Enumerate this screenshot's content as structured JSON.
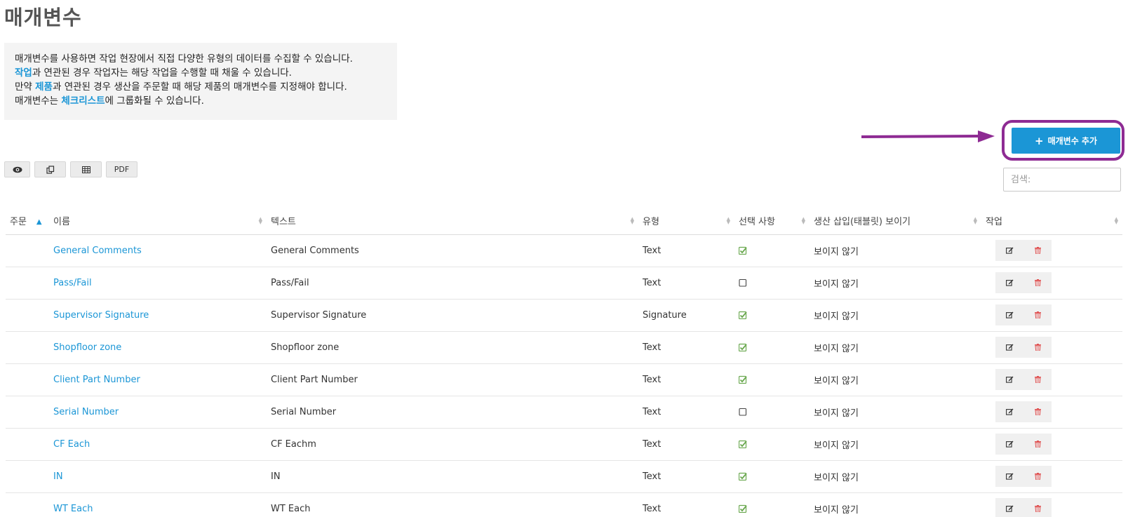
{
  "page": {
    "title": "매개변수"
  },
  "info": {
    "line1": "매개변수를 사용하면 작업 현장에서 직접 다양한 유형의 데이터를 수집할 수 있습니다.",
    "line2_link": "작업",
    "line2_rest": "과 연관된 경우 작업자는 해당 작업을 수행할 때 채울 수 있습니다.",
    "line3_pre": "만약 ",
    "line3_link": "제품",
    "line3_rest": "과 연관된 경우 생산을 주문할 때 해당 제품의 매개변수를 지정해야 합니다.",
    "line4_pre": "매개변수는 ",
    "line4_link": "체크리스트",
    "line4_rest": "에 그룹화될 수 있습니다."
  },
  "add_button": {
    "label": "매개변수 추가",
    "icon": "plus-icon",
    "color": "#1b96d6"
  },
  "annotation": {
    "color": "#8e2b93"
  },
  "toolbar": {
    "view_icon": "eye-icon",
    "copy_icon": "copy-icon",
    "excel_icon": "table-icon",
    "pdf_label": "PDF"
  },
  "search": {
    "placeholder": "검색:"
  },
  "table": {
    "columns": [
      "주문",
      "이름",
      "텍스트",
      "유형",
      "선택 사항",
      "생산 삽입(태블릿) 보이기",
      "작업"
    ],
    "rows": [
      {
        "name": "General Comments",
        "text": "General Comments",
        "type": "Text",
        "optional": true,
        "visible": "보이지 않기"
      },
      {
        "name": "Pass/Fail",
        "text": "Pass/Fail",
        "type": "Text",
        "optional": false,
        "visible": "보이지 않기"
      },
      {
        "name": "Supervisor Signature",
        "text": "Supervisor Signature",
        "type": "Signature",
        "optional": true,
        "visible": "보이지 않기"
      },
      {
        "name": "Shopfloor zone",
        "text": "Shopfloor zone",
        "type": "Text",
        "optional": true,
        "visible": "보이지 않기"
      },
      {
        "name": "Client Part Number",
        "text": "Client Part Number",
        "type": "Text",
        "optional": true,
        "visible": "보이지 않기"
      },
      {
        "name": "Serial Number",
        "text": "Serial Number",
        "type": "Text",
        "optional": false,
        "visible": "보이지 않기"
      },
      {
        "name": "CF Each",
        "text": "CF Eachm",
        "type": "Text",
        "optional": true,
        "visible": "보이지 않기"
      },
      {
        "name": "IN",
        "text": "IN",
        "type": "Text",
        "optional": true,
        "visible": "보이지 않기"
      },
      {
        "name": "WT Each",
        "text": "WT Each",
        "type": "Text",
        "optional": true,
        "visible": "보이지 않기"
      }
    ]
  }
}
